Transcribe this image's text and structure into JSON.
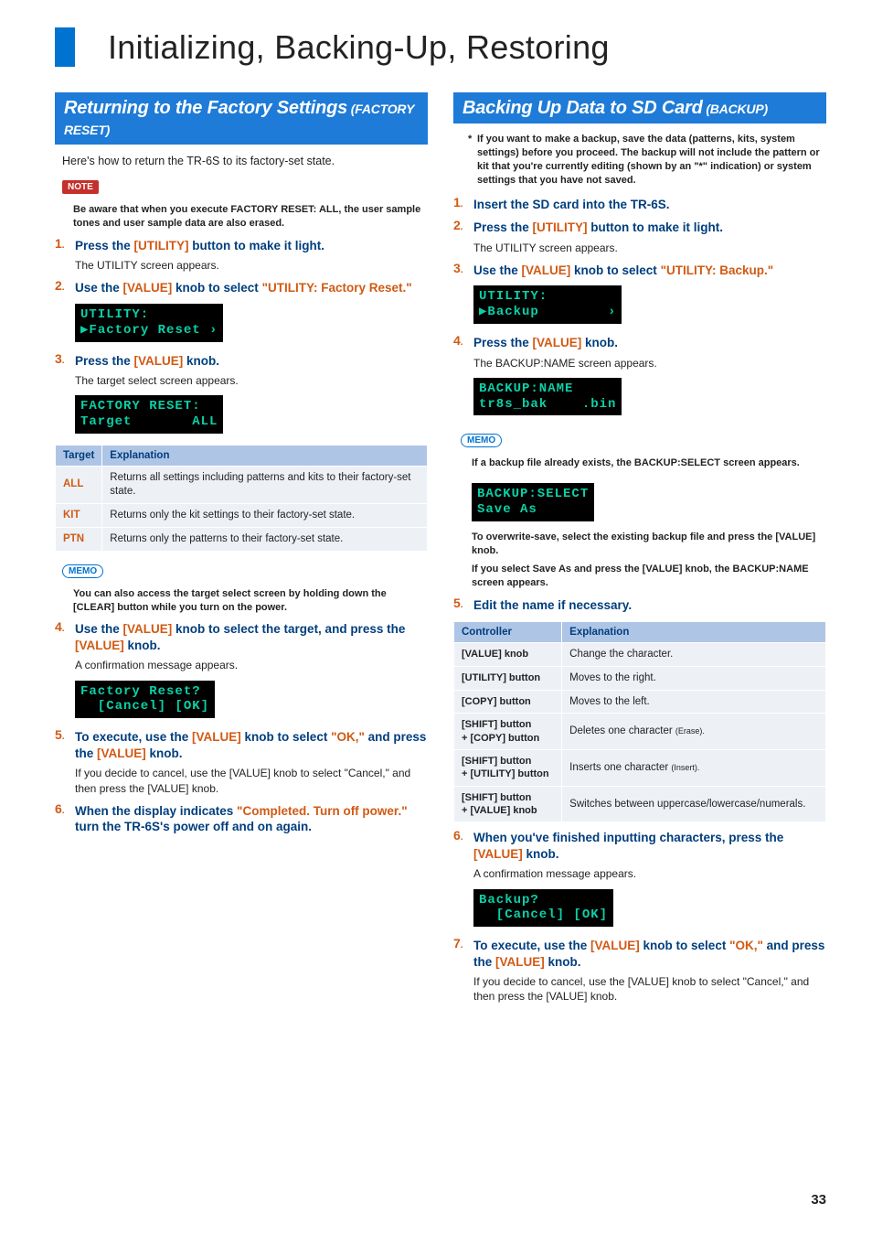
{
  "page": {
    "title": "Initializing, Backing-Up, Restoring",
    "number": "33"
  },
  "left": {
    "section_title": "Returning to the Factory Settings",
    "section_sub": " (FACTORY RESET)",
    "intro": "Here's how to return the TR-6S to its factory-set state.",
    "note_tag": "NOTE",
    "note_body": "Be aware that when you execute FACTORY RESET: ALL, the user sample tones and user sample data are also erased.",
    "steps": {
      "s1": {
        "head_pre": "Press the ",
        "head_orange": "[UTILITY]",
        "head_post": " button to make it light.",
        "sub": "The UTILITY screen appears."
      },
      "s2": {
        "head_pre": "Use the ",
        "head_orange": "[VALUE]",
        "head_mid": " knob to select ",
        "head_orange2": "\"UTILITY: Factory Reset.\"",
        "lcd": "UTILITY:\n▶Factory Reset ›"
      },
      "s3": {
        "head_pre": "Press the ",
        "head_orange": "[VALUE]",
        "head_post": " knob.",
        "sub": "The target select screen appears.",
        "lcd": "FACTORY RESET:\nTarget       ALL"
      },
      "s4": {
        "head_pre": "Use the ",
        "head_orange": "[VALUE]",
        "head_mid": " knob to select the target, and press the ",
        "head_orange2": "[VALUE]",
        "head_post": " knob.",
        "sub": "A confirmation message appears.",
        "lcd": "Factory Reset?\n  [Cancel] [OK]"
      },
      "s5": {
        "head_pre": "To execute, use the ",
        "head_orange": "[VALUE]",
        "head_mid": " knob to select ",
        "head_orange2": "\"OK,\"",
        "head_mid2": " and press the ",
        "head_orange3": "[VALUE]",
        "head_post": " knob.",
        "sub": "If you decide to cancel, use the [VALUE] knob to select \"Cancel,\" and then press the [VALUE] knob."
      },
      "s6": {
        "head_pre": "When the display indicates ",
        "head_orange": "\"Completed. Turn off power.\"",
        "head_post": " turn the TR-6S's power off and on again."
      }
    },
    "target_table": {
      "headers": [
        "Target",
        "Explanation"
      ],
      "rows": [
        {
          "k": "ALL",
          "v": "Returns all settings including patterns and kits to their factory-set state."
        },
        {
          "k": "KIT",
          "v": "Returns only the kit settings to their factory-set state."
        },
        {
          "k": "PTN",
          "v": "Returns only the patterns to their factory-set state."
        }
      ]
    },
    "memo_tag": "MEMO",
    "memo_body": "You can also access the target select screen by holding down the [CLEAR] button while you turn on the power."
  },
  "right": {
    "section_title": "Backing Up Data to SD Card",
    "section_sub": " (BACKUP)",
    "warn": "If you want to make a backup, save the data (patterns, kits, system settings) before you proceed. The backup will not include the pattern or kit that you're currently editing (shown by an \"*\" indication) or system settings that you have not saved.",
    "steps": {
      "s1": {
        "head": "Insert the SD card into the TR-6S."
      },
      "s2": {
        "head_pre": "Press the ",
        "head_orange": "[UTILITY]",
        "head_post": " button to make it light.",
        "sub": "The UTILITY screen appears."
      },
      "s3": {
        "head_pre": "Use the ",
        "head_orange": "[VALUE]",
        "head_mid": " knob to select ",
        "head_orange2": "\"UTILITY: Backup.\"",
        "lcd": "UTILITY:\n▶Backup        ›"
      },
      "s4": {
        "head_pre": "Press the ",
        "head_orange": "[VALUE]",
        "head_post": " knob.",
        "sub": "The BACKUP:NAME screen appears.",
        "lcd": "BACKUP:NAME\ntr8s_bak    .bin"
      },
      "s5": {
        "head": "Edit the name if necessary."
      },
      "s6": {
        "head_pre": "When you've finished inputting characters, press the ",
        "head_orange": "[VALUE]",
        "head_post": " knob.",
        "sub": "A confirmation message appears.",
        "lcd": "Backup?\n  [Cancel] [OK]"
      },
      "s7": {
        "head_pre": "To execute, use the ",
        "head_orange": "[VALUE]",
        "head_mid": " knob to select ",
        "head_orange2": "\"OK,\"",
        "head_mid2": " and press the ",
        "head_orange3": "[VALUE]",
        "head_post": " knob.",
        "sub": "If you decide to cancel, use the [VALUE] knob to select \"Cancel,\" and then press the [VALUE] knob."
      }
    },
    "memo_tag": "MEMO",
    "memo1": "If a backup file already exists, the BACKUP:SELECT screen appears.",
    "memo_lcd": "BACKUP:SELECT\nSave As",
    "memo2": "To overwrite-save, select the existing backup file and press the [VALUE] knob.",
    "memo3": "If you select Save As and press the [VALUE] knob, the BACKUP:NAME screen appears.",
    "edit_table": {
      "headers": [
        "Controller",
        "Explanation"
      ],
      "rows": [
        {
          "k": "[VALUE] knob",
          "v": "Change the character."
        },
        {
          "k": "[UTILITY] button",
          "v": "Moves to the right."
        },
        {
          "k": "[COPY] button",
          "v": "Moves to the left."
        },
        {
          "k": "[SHIFT] button\n+ [COPY] button",
          "v": "Deletes one character",
          "t": "(Erase)."
        },
        {
          "k": "[SHIFT] button\n+ [UTILITY] button",
          "v": "Inserts one character",
          "t": "(Insert)."
        },
        {
          "k": "[SHIFT] button\n+ [VALUE] knob",
          "v": "Switches between uppercase/lowercase/numerals."
        }
      ]
    }
  }
}
